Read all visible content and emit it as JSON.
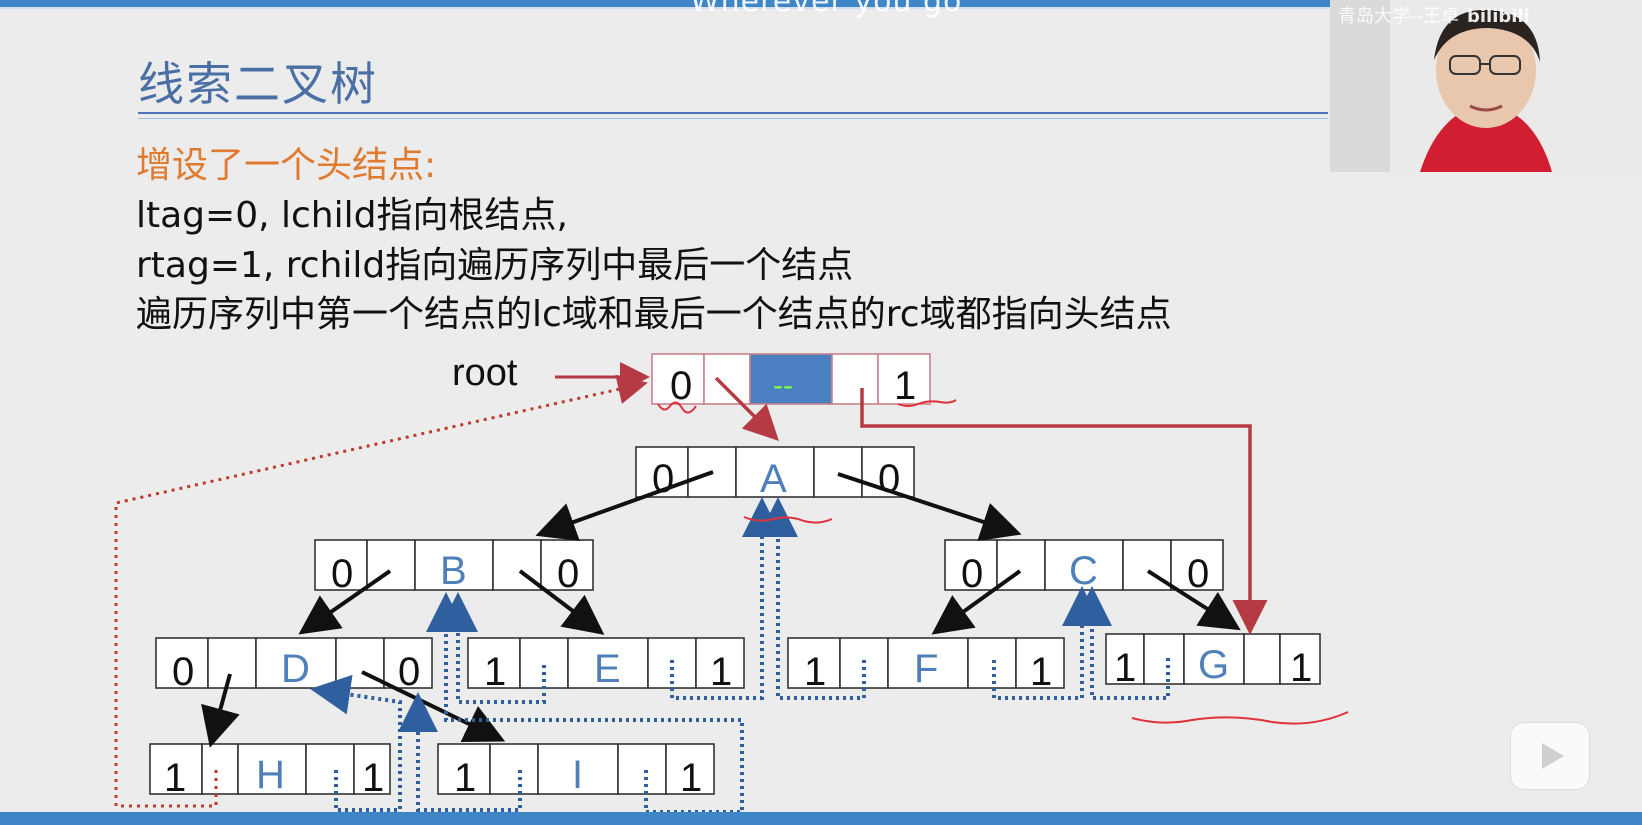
{
  "slide": {
    "subtitle": "Wherever you go",
    "title": "线索二叉树",
    "lead": "增设了一个头结点:",
    "lines": [
      "ltag=0, lchild指向根结点,",
      "rtag=1, rchild指向遍历序列中最后一个结点",
      "遍历序列中第一个结点的lc域和最后一个结点的rc域都指向头结点"
    ]
  },
  "video": {
    "watermark": "青岛大学--王卓",
    "platform": "bilibili"
  },
  "diagram": {
    "root_label": "root",
    "head": {
      "ltag": "0",
      "data": "--",
      "rtag": "1"
    },
    "nodes": [
      {
        "name": "A",
        "ltag": "0",
        "rtag": "0"
      },
      {
        "name": "B",
        "ltag": "0",
        "rtag": "0"
      },
      {
        "name": "C",
        "ltag": "0",
        "rtag": "0"
      },
      {
        "name": "D",
        "ltag": "0",
        "rtag": "0"
      },
      {
        "name": "E",
        "ltag": "1",
        "rtag": "1"
      },
      {
        "name": "F",
        "ltag": "1",
        "rtag": "1"
      },
      {
        "name": "G",
        "ltag": "1",
        "rtag": "1"
      },
      {
        "name": "H",
        "ltag": "1",
        "rtag": "1"
      },
      {
        "name": "I",
        "ltag": "1",
        "rtag": "1"
      }
    ]
  },
  "colors": {
    "accent_blue": "#3f86c7",
    "title_blue": "#4a6fa5",
    "lead_orange": "#e07a2e",
    "head_fill": "#4a7fc1",
    "thread_red": "#b53a44",
    "thread_blue": "#2f5f9e",
    "annot_red": "#e0323c"
  }
}
